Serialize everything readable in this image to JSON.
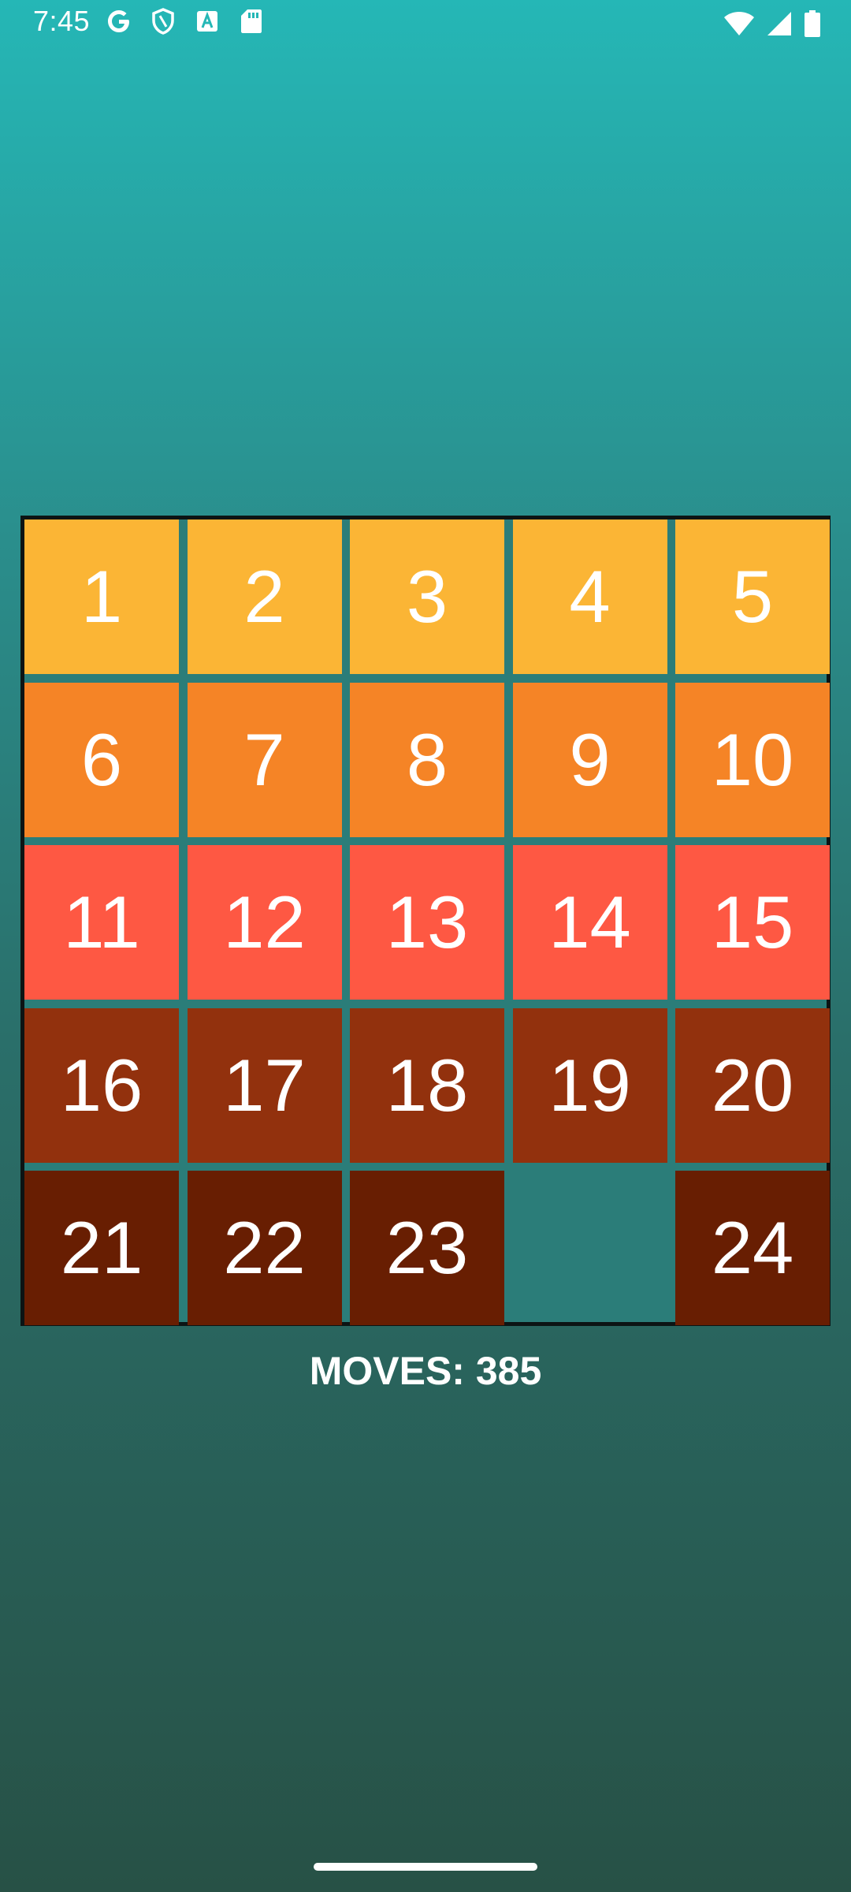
{
  "status_bar": {
    "time": "7:45",
    "left_icons": [
      "google-icon",
      "shield-icon",
      "font-a-icon",
      "sd-card-icon"
    ],
    "right_icons": [
      "wifi-icon",
      "cellular-signal-icon",
      "battery-icon"
    ]
  },
  "board": {
    "rows": [
      [
        "1",
        "2",
        "3",
        "4",
        "5"
      ],
      [
        "6",
        "7",
        "8",
        "9",
        "10"
      ],
      [
        "11",
        "12",
        "13",
        "14",
        "15"
      ],
      [
        "16",
        "17",
        "18",
        "19",
        "20"
      ],
      [
        "21",
        "22",
        "23",
        "",
        "24"
      ]
    ],
    "row_colors": [
      "#fbb535",
      "#f58426",
      "#fe5843",
      "#92310d",
      "#681e02"
    ]
  },
  "moves": {
    "label": "MOVES:",
    "value": "385"
  }
}
